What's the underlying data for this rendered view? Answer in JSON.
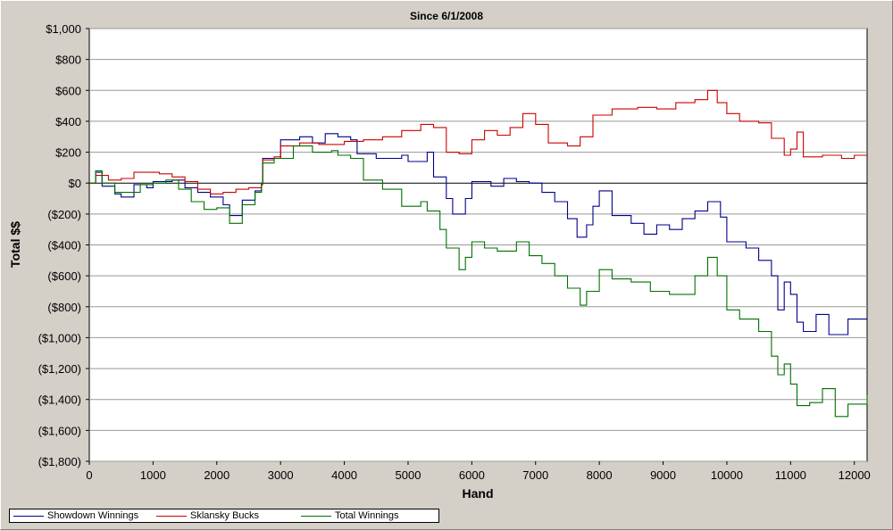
{
  "chart_data": {
    "type": "line",
    "title": "Since 6/1/2008",
    "xlabel": "Hand",
    "ylabel": "Total $$",
    "xlim": [
      0,
      12200
    ],
    "ylim": [
      -1800,
      1000
    ],
    "grid": true,
    "legend_position": "bottom-left",
    "x_ticks": [
      0,
      1000,
      2000,
      3000,
      4000,
      5000,
      6000,
      7000,
      8000,
      9000,
      10000,
      11000,
      12000
    ],
    "y_ticks": [
      1000,
      800,
      600,
      400,
      200,
      0,
      -200,
      -400,
      -600,
      -800,
      -1000,
      -1200,
      -1400,
      -1600,
      -1800
    ],
    "y_tick_labels": [
      "$1,000",
      "$800",
      "$600",
      "$400",
      "$200",
      "$0",
      "($200)",
      "($400)",
      "($600)",
      "($800)",
      "($1,000)",
      "($1,200)",
      "($1,400)",
      "($1,600)",
      "($1,800)"
    ],
    "series": [
      {
        "name": "Showdown Winnings",
        "color": "#00008b",
        "points": [
          [
            0,
            0
          ],
          [
            100,
            70
          ],
          [
            200,
            -20
          ],
          [
            400,
            -70
          ],
          [
            500,
            -90
          ],
          [
            700,
            -10
          ],
          [
            900,
            -30
          ],
          [
            1000,
            10
          ],
          [
            1300,
            20
          ],
          [
            1500,
            -30
          ],
          [
            1700,
            -60
          ],
          [
            1900,
            -90
          ],
          [
            2100,
            -140
          ],
          [
            2200,
            -210
          ],
          [
            2400,
            -110
          ],
          [
            2600,
            -50
          ],
          [
            2700,
            0
          ],
          [
            2720,
            160
          ],
          [
            2900,
            160
          ],
          [
            3000,
            280
          ],
          [
            3300,
            300
          ],
          [
            3500,
            260
          ],
          [
            3700,
            320
          ],
          [
            3900,
            300
          ],
          [
            4100,
            280
          ],
          [
            4200,
            190
          ],
          [
            4500,
            160
          ],
          [
            4900,
            180
          ],
          [
            5000,
            140
          ],
          [
            5300,
            200
          ],
          [
            5400,
            40
          ],
          [
            5600,
            -100
          ],
          [
            5700,
            -200
          ],
          [
            5900,
            -100
          ],
          [
            6000,
            10
          ],
          [
            6300,
            -20
          ],
          [
            6500,
            30
          ],
          [
            6700,
            10
          ],
          [
            6900,
            0
          ],
          [
            7100,
            -60
          ],
          [
            7300,
            -120
          ],
          [
            7500,
            -230
          ],
          [
            7650,
            -350
          ],
          [
            7800,
            -270
          ],
          [
            7900,
            -150
          ],
          [
            8000,
            -50
          ],
          [
            8200,
            -210
          ],
          [
            8500,
            -260
          ],
          [
            8700,
            -330
          ],
          [
            8900,
            -270
          ],
          [
            9100,
            -300
          ],
          [
            9300,
            -230
          ],
          [
            9500,
            -180
          ],
          [
            9700,
            -120
          ],
          [
            9900,
            -220
          ],
          [
            10000,
            -380
          ],
          [
            10300,
            -420
          ],
          [
            10500,
            -500
          ],
          [
            10700,
            -600
          ],
          [
            10800,
            -820
          ],
          [
            10900,
            -640
          ],
          [
            11000,
            -720
          ],
          [
            11100,
            -900
          ],
          [
            11200,
            -960
          ],
          [
            11400,
            -850
          ],
          [
            11600,
            -980
          ],
          [
            11900,
            -880
          ],
          [
            12200,
            -870
          ]
        ]
      },
      {
        "name": "Sklansky Bucks",
        "color": "#cc0000",
        "points": [
          [
            0,
            0
          ],
          [
            100,
            50
          ],
          [
            300,
            20
          ],
          [
            500,
            30
          ],
          [
            700,
            70
          ],
          [
            900,
            70
          ],
          [
            1100,
            60
          ],
          [
            1300,
            40
          ],
          [
            1500,
            10
          ],
          [
            1700,
            -40
          ],
          [
            1900,
            -70
          ],
          [
            2100,
            -60
          ],
          [
            2300,
            -40
          ],
          [
            2500,
            -30
          ],
          [
            2700,
            -10
          ],
          [
            2720,
            150
          ],
          [
            2900,
            170
          ],
          [
            3000,
            240
          ],
          [
            3300,
            260
          ],
          [
            3600,
            250
          ],
          [
            4000,
            270
          ],
          [
            4300,
            280
          ],
          [
            4600,
            300
          ],
          [
            4900,
            340
          ],
          [
            5200,
            380
          ],
          [
            5400,
            360
          ],
          [
            5600,
            200
          ],
          [
            5800,
            190
          ],
          [
            6000,
            280
          ],
          [
            6200,
            340
          ],
          [
            6400,
            310
          ],
          [
            6600,
            360
          ],
          [
            6800,
            450
          ],
          [
            7000,
            380
          ],
          [
            7200,
            260
          ],
          [
            7500,
            240
          ],
          [
            7700,
            300
          ],
          [
            7900,
            440
          ],
          [
            8200,
            480
          ],
          [
            8600,
            490
          ],
          [
            8900,
            480
          ],
          [
            9200,
            520
          ],
          [
            9500,
            540
          ],
          [
            9700,
            600
          ],
          [
            9850,
            520
          ],
          [
            10000,
            450
          ],
          [
            10200,
            400
          ],
          [
            10500,
            390
          ],
          [
            10700,
            290
          ],
          [
            10900,
            180
          ],
          [
            11000,
            220
          ],
          [
            11100,
            330
          ],
          [
            11200,
            170
          ],
          [
            11500,
            180
          ],
          [
            11800,
            160
          ],
          [
            12000,
            180
          ],
          [
            12200,
            180
          ]
        ]
      },
      {
        "name": "Total Winnings",
        "color": "#007000",
        "points": [
          [
            0,
            0
          ],
          [
            100,
            80
          ],
          [
            200,
            0
          ],
          [
            400,
            -60
          ],
          [
            600,
            -60
          ],
          [
            800,
            -10
          ],
          [
            1000,
            0
          ],
          [
            1200,
            20
          ],
          [
            1400,
            -40
          ],
          [
            1600,
            -120
          ],
          [
            1800,
            -170
          ],
          [
            2000,
            -160
          ],
          [
            2200,
            -260
          ],
          [
            2400,
            -140
          ],
          [
            2600,
            -60
          ],
          [
            2700,
            0
          ],
          [
            2720,
            130
          ],
          [
            2900,
            160
          ],
          [
            3000,
            160
          ],
          [
            3200,
            240
          ],
          [
            3500,
            200
          ],
          [
            3800,
            210
          ],
          [
            3900,
            180
          ],
          [
            4100,
            160
          ],
          [
            4300,
            20
          ],
          [
            4600,
            -40
          ],
          [
            4900,
            -150
          ],
          [
            5200,
            -120
          ],
          [
            5300,
            -180
          ],
          [
            5500,
            -300
          ],
          [
            5600,
            -420
          ],
          [
            5800,
            -560
          ],
          [
            5900,
            -480
          ],
          [
            6000,
            -380
          ],
          [
            6200,
            -420
          ],
          [
            6400,
            -440
          ],
          [
            6700,
            -380
          ],
          [
            6900,
            -470
          ],
          [
            7100,
            -520
          ],
          [
            7300,
            -600
          ],
          [
            7500,
            -680
          ],
          [
            7700,
            -790
          ],
          [
            7800,
            -700
          ],
          [
            8000,
            -560
          ],
          [
            8200,
            -620
          ],
          [
            8500,
            -640
          ],
          [
            8800,
            -700
          ],
          [
            9100,
            -720
          ],
          [
            9300,
            -720
          ],
          [
            9500,
            -600
          ],
          [
            9700,
            -480
          ],
          [
            9850,
            -600
          ],
          [
            10000,
            -820
          ],
          [
            10200,
            -880
          ],
          [
            10500,
            -960
          ],
          [
            10700,
            -1120
          ],
          [
            10800,
            -1240
          ],
          [
            10900,
            -1170
          ],
          [
            11000,
            -1300
          ],
          [
            11100,
            -1440
          ],
          [
            11300,
            -1420
          ],
          [
            11500,
            -1330
          ],
          [
            11700,
            -1510
          ],
          [
            11900,
            -1430
          ],
          [
            12200,
            -1370
          ]
        ]
      }
    ]
  }
}
